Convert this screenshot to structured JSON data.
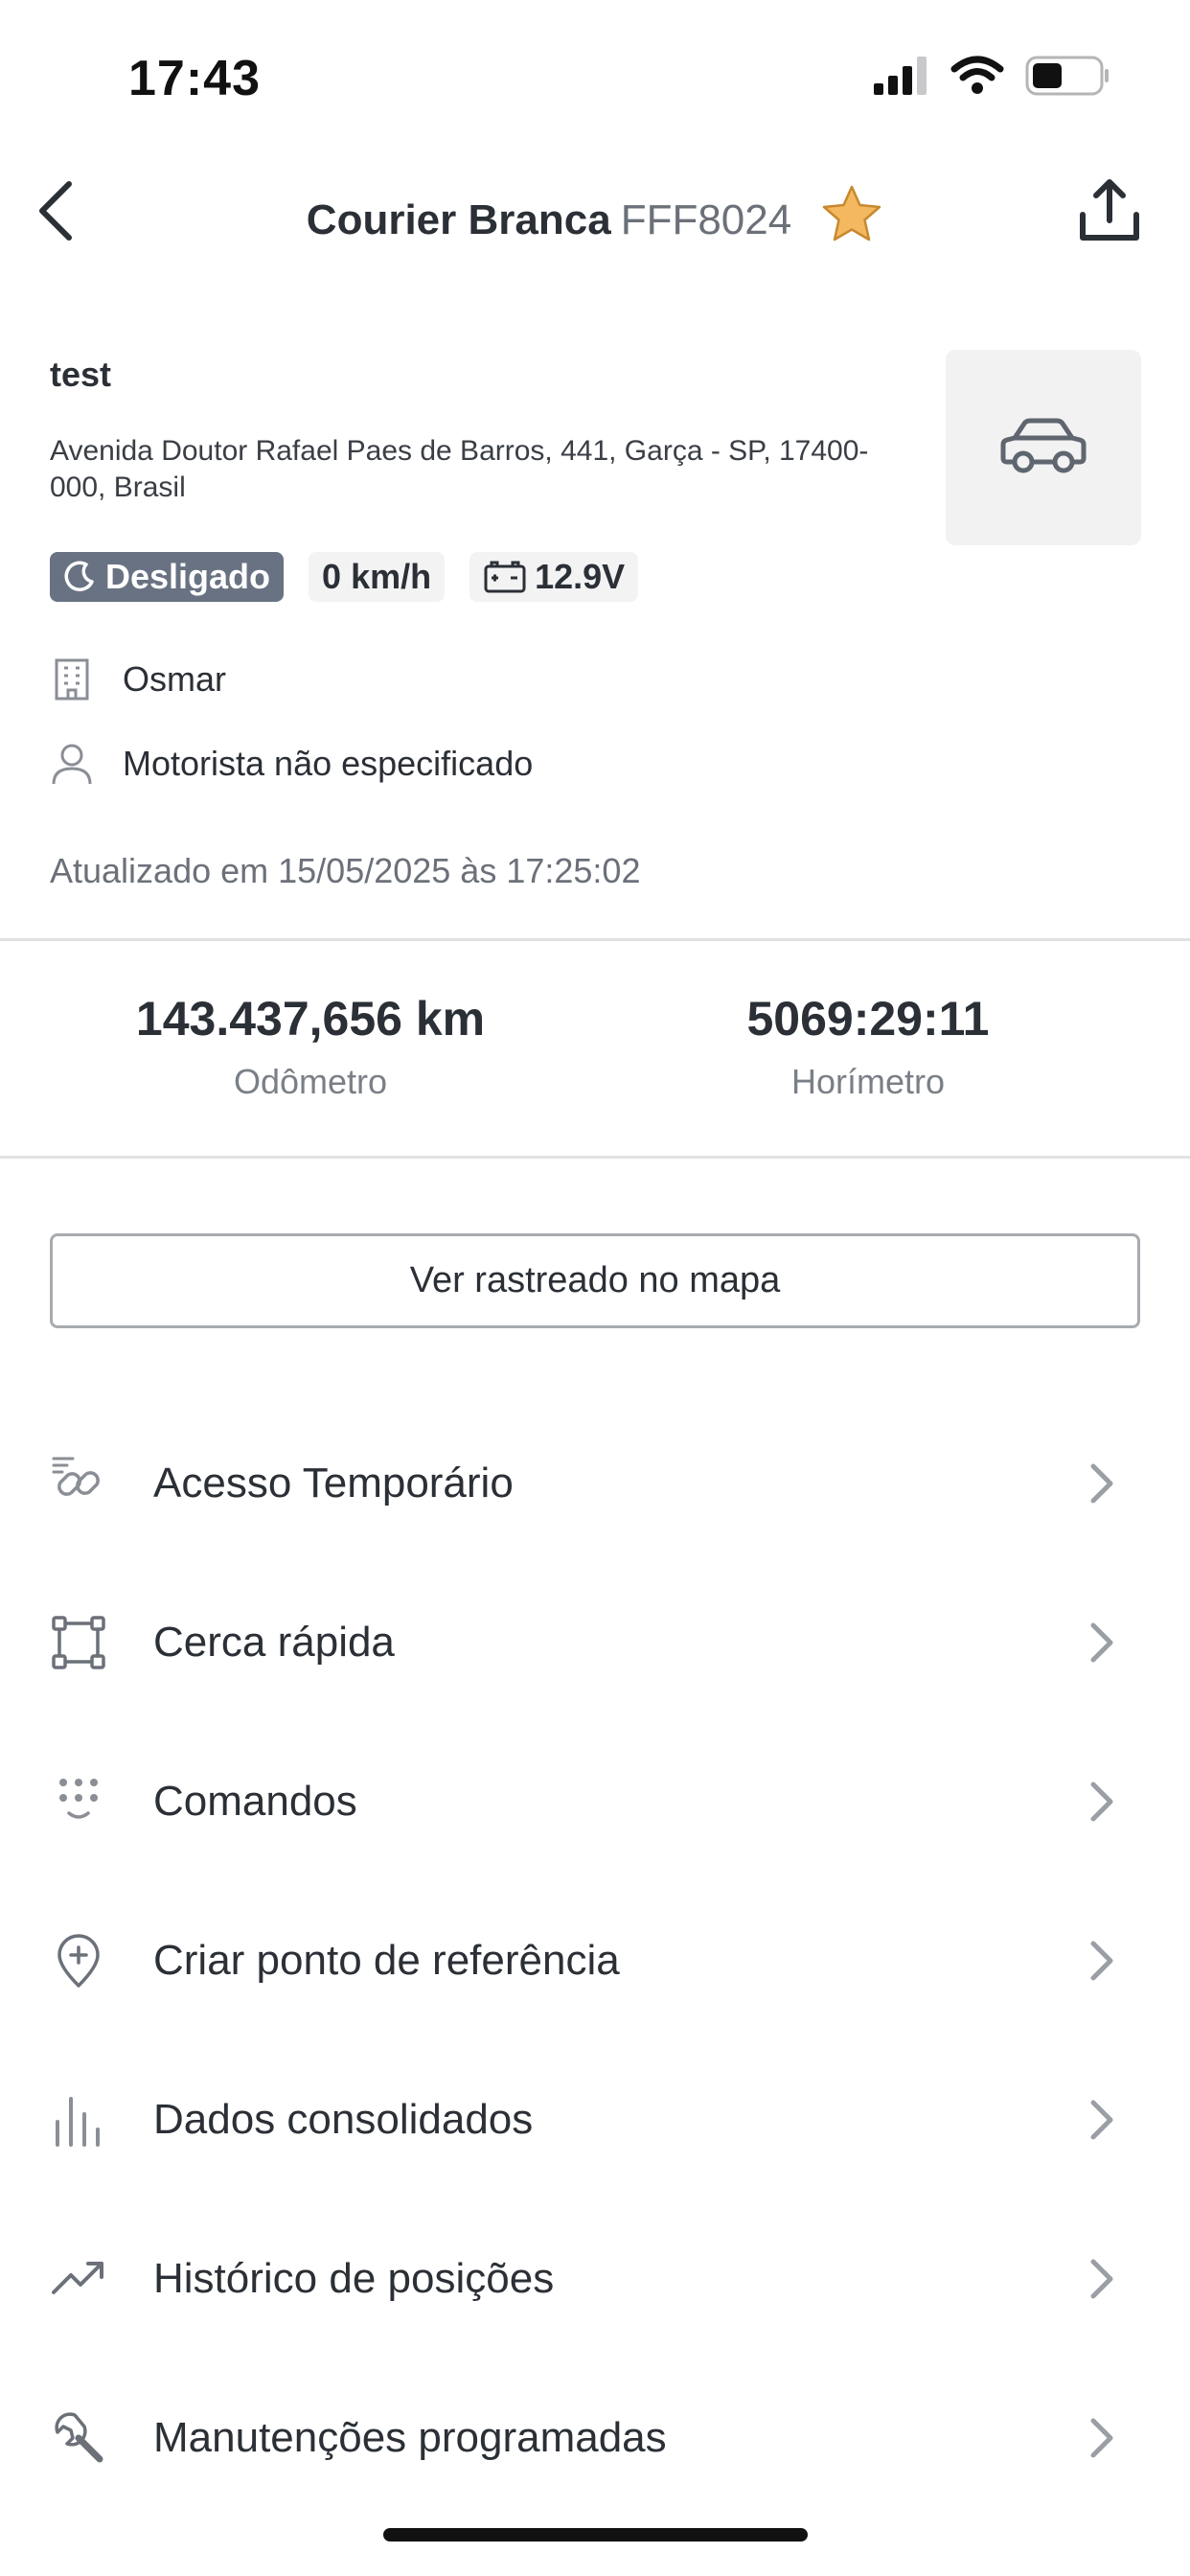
{
  "status_bar": {
    "time": "17:43"
  },
  "header": {
    "name": "Courier Branca",
    "plate": "FFF8024"
  },
  "vehicle": {
    "name": "test",
    "address": "Avenida Doutor Rafael Paes de Barros, 441, Garça - SP, 17400-000, Brasil",
    "status": "Desligado",
    "speed": "0 km/h",
    "battery": "12.9V",
    "company": "Osmar",
    "driver": "Motorista não especificado",
    "updated": "Atualizado em 15/05/2025 às 17:25:02"
  },
  "stats": {
    "odometer_value": "143.437,656 km",
    "odometer_label": "Odômetro",
    "hourmeter_value": "5069:29:11",
    "hourmeter_label": "Horímetro"
  },
  "map_button": "Ver rastreado no mapa",
  "menu": [
    {
      "label": "Acesso Temporário",
      "icon": "link-icon"
    },
    {
      "label": "Cerca rápida",
      "icon": "fence-icon"
    },
    {
      "label": "Comandos",
      "icon": "keypad-icon"
    },
    {
      "label": "Criar ponto de referência",
      "icon": "map-pin-plus-icon"
    },
    {
      "label": "Dados consolidados",
      "icon": "bar-chart-icon"
    },
    {
      "label": "Histórico de posições",
      "icon": "trending-up-icon"
    },
    {
      "label": "Manutenções programadas",
      "icon": "wrench-icon"
    }
  ],
  "colors": {
    "text": "#2b2f36",
    "muted": "#6b7079",
    "status_badge": "#687282",
    "star": "#f4b860",
    "icon": "#6b7079"
  }
}
